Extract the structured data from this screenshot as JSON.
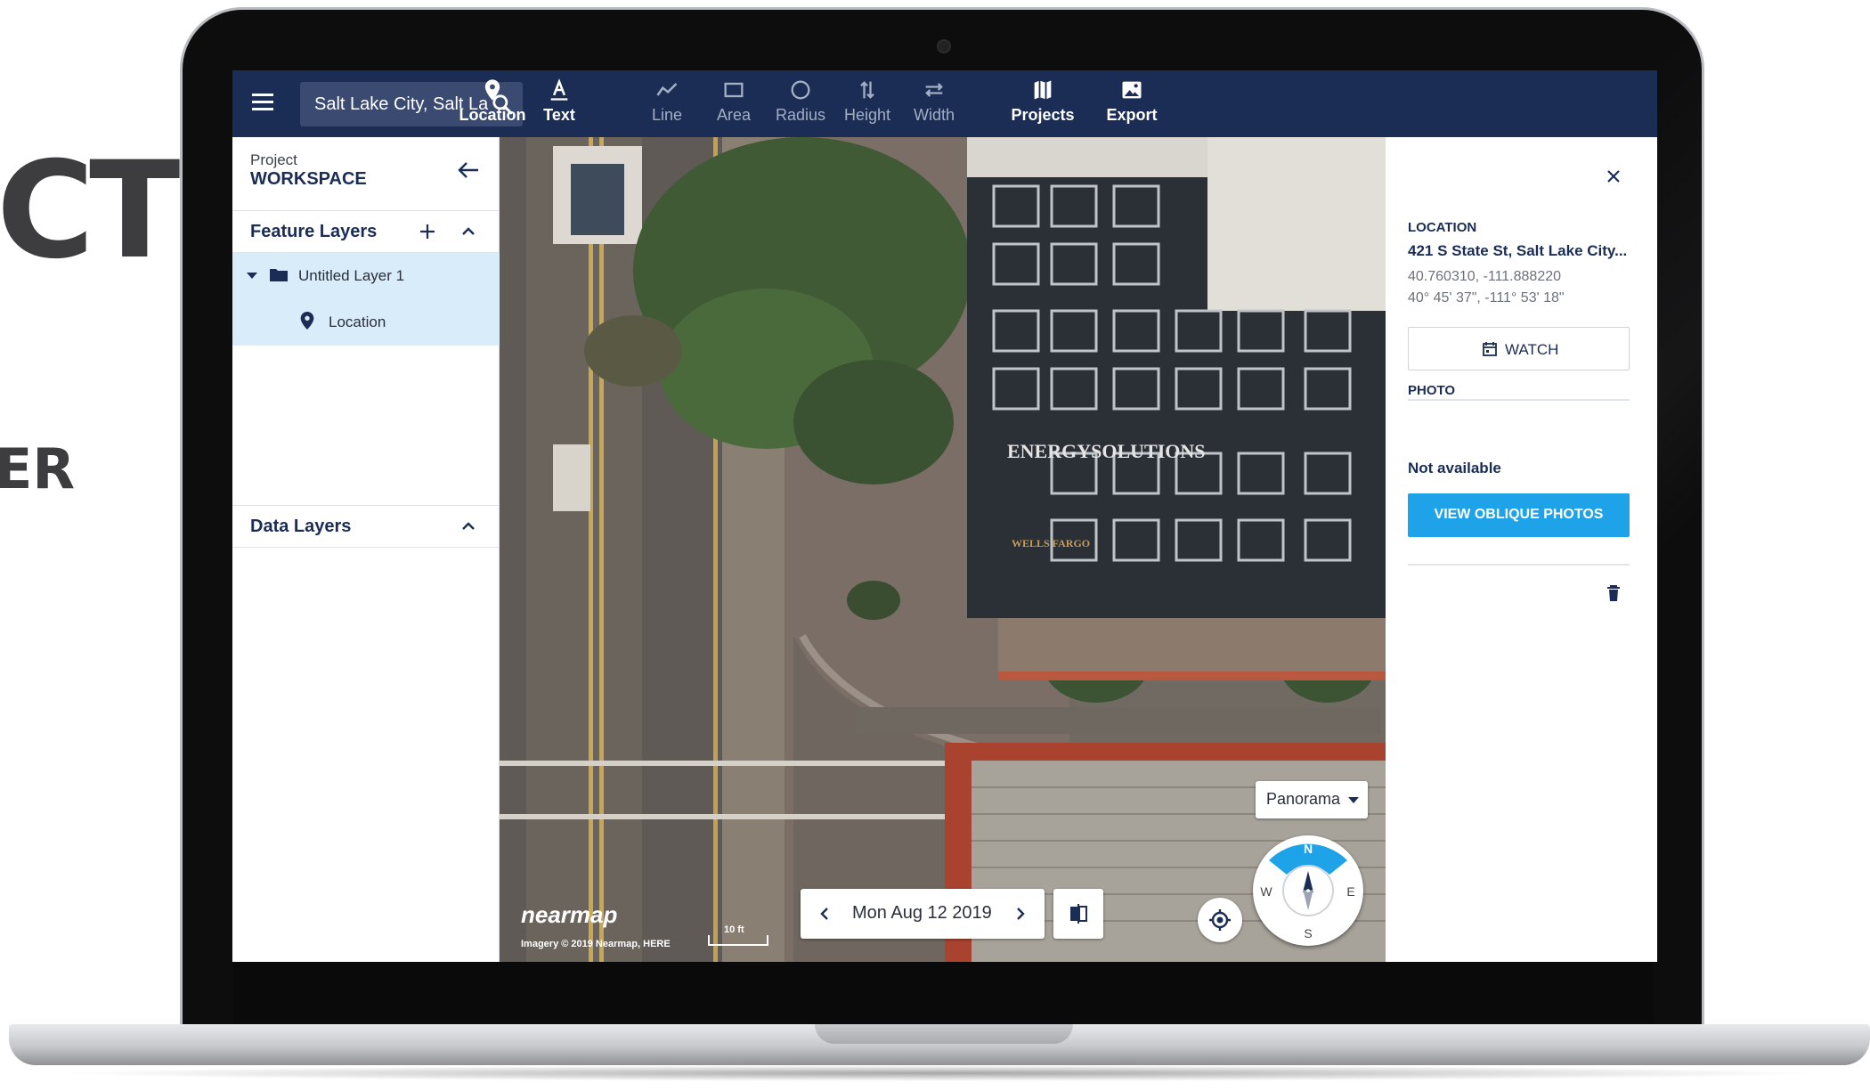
{
  "background": {
    "headline_fragment": "CT",
    "sub_fragment": "ER"
  },
  "toolbar": {
    "search_value": "Salt Lake City, Salt Lake",
    "tools": [
      {
        "label": "Location",
        "icon": "location-pin-icon",
        "active": true
      },
      {
        "label": "Text",
        "icon": "text-icon",
        "active": true
      },
      {
        "label": "Line",
        "icon": "line-icon",
        "active": false
      },
      {
        "label": "Area",
        "icon": "area-icon",
        "active": false
      },
      {
        "label": "Radius",
        "icon": "radius-icon",
        "active": false
      },
      {
        "label": "Height",
        "icon": "height-icon",
        "active": false
      },
      {
        "label": "Width",
        "icon": "width-icon",
        "active": false
      },
      {
        "label": "Projects",
        "icon": "projects-map-icon",
        "active": true
      },
      {
        "label": "Export",
        "icon": "export-image-icon",
        "active": true
      }
    ]
  },
  "sidebar": {
    "project_label": "Project",
    "project_name": "WORKSPACE",
    "feature_layers_title": "Feature Layers",
    "layers": [
      {
        "name": "Untitled Layer 1",
        "children": [
          "Location"
        ]
      }
    ],
    "data_layers_title": "Data Layers"
  },
  "map": {
    "view_mode": "Panorama",
    "date": "Mon Aug 12 2019",
    "compass": {
      "n": "N",
      "e": "E",
      "s": "S",
      "w": "W"
    },
    "logo": "nearmap",
    "credit": "Imagery © 2019 Nearmap, HERE",
    "scale": "10 ft",
    "building_sign": "ENERGYSOLUTIONS",
    "bank_sign": "WELLS FARGO"
  },
  "details": {
    "location_caption": "LOCATION",
    "address": "421 S State St, Salt Lake City...",
    "coord_decimal": "40.760310, -111.888220",
    "coord_dms": "40° 45' 37\", -111° 53' 18\"",
    "watch_label": "WATCH",
    "photo_caption": "PHOTO",
    "photo_status": "Not available",
    "oblique_label": "VIEW OBLIQUE PHOTOS"
  },
  "colors": {
    "toolbar_bg": "#1b2d55",
    "accent": "#1fa3e8",
    "selected_row": "#d9ecfa"
  }
}
